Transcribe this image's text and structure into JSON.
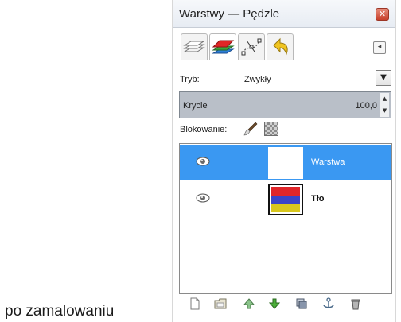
{
  "caption": "po zamalowaniu",
  "window": {
    "title": "Warstwy — Pędzle",
    "close_glyph": "✕"
  },
  "tabs": [
    {
      "icon": "layers-icon",
      "active": false
    },
    {
      "icon": "channels-icon",
      "active": true
    },
    {
      "icon": "paths-icon",
      "active": false
    },
    {
      "icon": "undo-history-icon",
      "active": false
    }
  ],
  "tab_menu_glyph": "◂",
  "mode": {
    "label": "Tryb:",
    "value": "Zwykły",
    "arrow": "▼"
  },
  "opacity": {
    "label": "Krycie",
    "value": "100,0",
    "spin_up": "▲",
    "spin_down": "▼"
  },
  "lock": {
    "label": "Blokowanie:"
  },
  "layers": [
    {
      "name": "Warstwa",
      "selected": true,
      "visible": true
    },
    {
      "name": "Tło",
      "selected": false,
      "visible": true
    }
  ],
  "bottom_toolbar": [
    "new-layer-icon",
    "new-layer-group-icon",
    "raise-layer-icon",
    "lower-layer-icon",
    "duplicate-layer-icon",
    "anchor-layer-icon",
    "delete-layer-icon"
  ],
  "colors": {
    "selection": "#3a98f2",
    "opacity_bar": "#b9bfc8",
    "thumb_red": "#e0262a",
    "thumb_blue": "#3a44c8",
    "thumb_yellow": "#d8c71e"
  }
}
